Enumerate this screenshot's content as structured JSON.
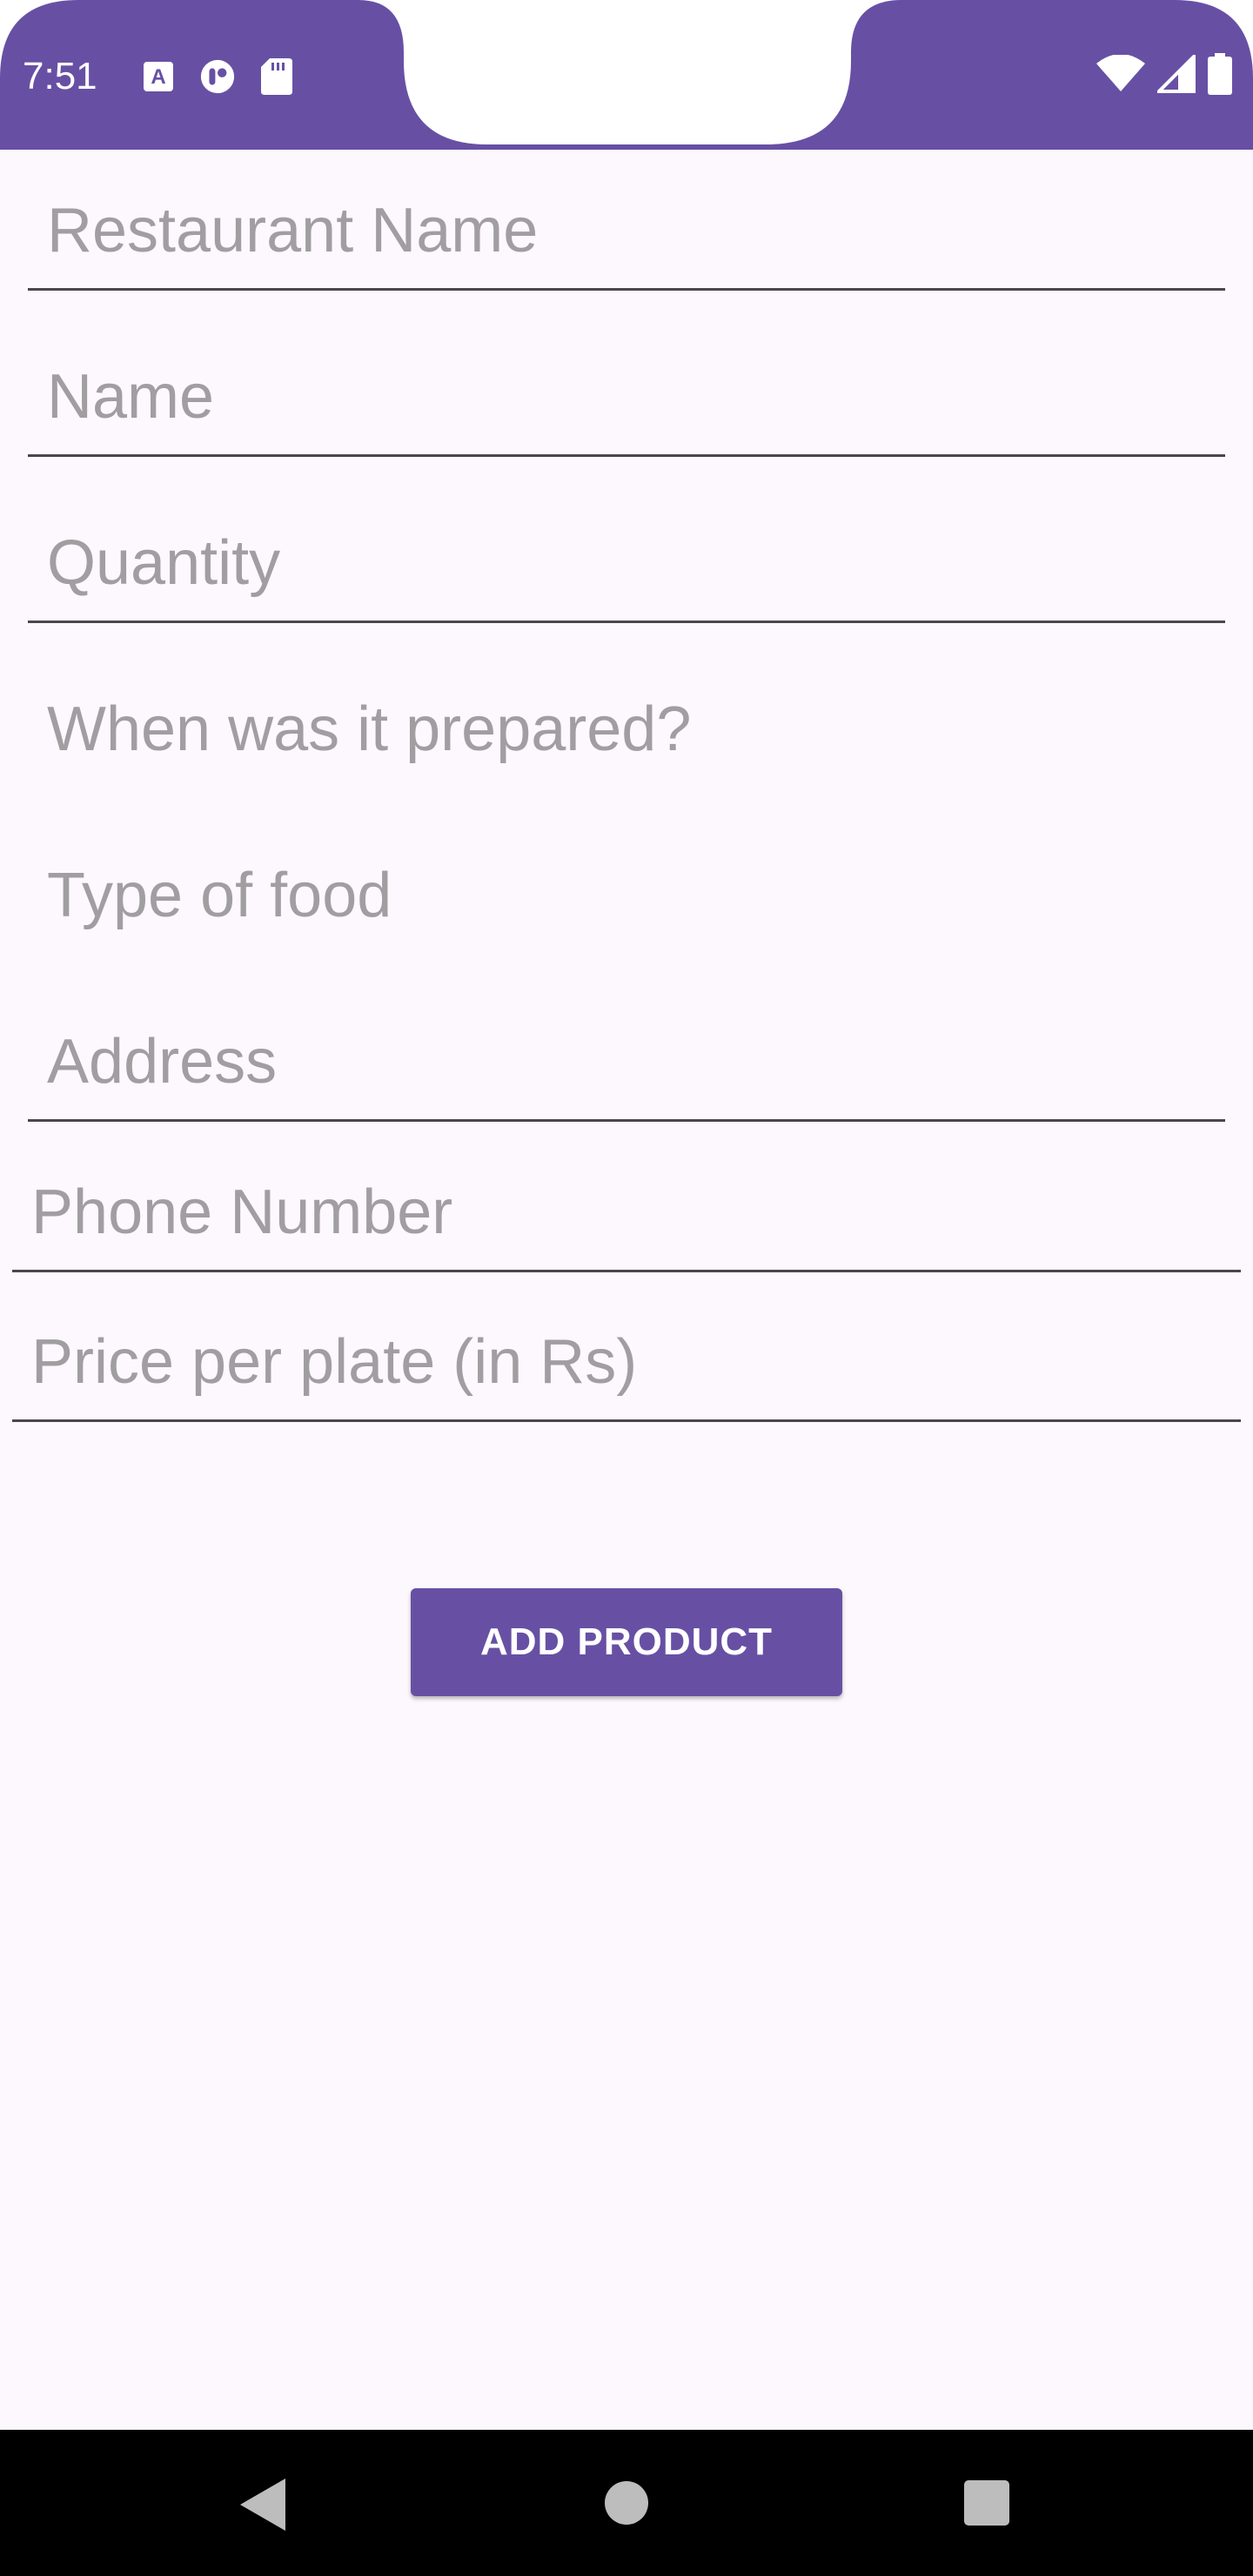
{
  "status_bar": {
    "time": "7:51",
    "color": "#6750a4",
    "icons_left": [
      "text-recognition-icon",
      "app-notification-icon",
      "sd-card-icon"
    ],
    "icons_right": [
      "wifi-icon",
      "cellular-signal-icon",
      "battery-icon"
    ]
  },
  "form": {
    "restaurant_name_placeholder": "Restaurant Name",
    "name_placeholder": "Name",
    "quantity_placeholder": "Quantity",
    "prepared_placeholder": "When was it prepared?",
    "food_type_placeholder": "Type of food",
    "address_placeholder": "Address",
    "phone_placeholder": "Phone Number",
    "price_placeholder": "Price per plate (in Rs)"
  },
  "actions": {
    "add_product_label": "ADD PRODUCT"
  },
  "nav_bar": {
    "icons": [
      "back-icon",
      "home-icon",
      "recents-icon"
    ]
  },
  "colors": {
    "accent": "#6750a4",
    "background": "#fdf8fd",
    "placeholder": "#a19ea2",
    "underline": "#4a474c"
  }
}
